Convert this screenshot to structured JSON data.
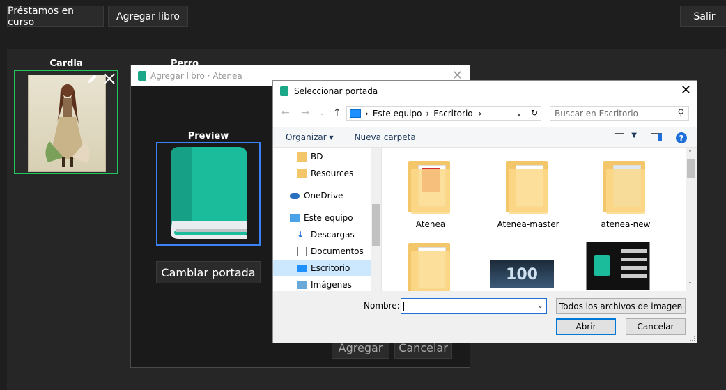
{
  "topbar": {
    "loans_label": "Préstamos en curso",
    "add_book_label": "Agregar libro",
    "exit_label": "Salir"
  },
  "library": {
    "books": [
      {
        "title": "Cardia"
      },
      {
        "title": "Perro"
      }
    ]
  },
  "add_dialog": {
    "title": "Agregar libro · Atenea",
    "preview_label": "Preview",
    "change_cover_label": "Cambiar portada",
    "add_label": "Agregar",
    "cancel_label": "Cancelar"
  },
  "file_dialog": {
    "title": "Seleccionar portada",
    "breadcrumb": [
      "Este equipo",
      "Escritorio"
    ],
    "search_placeholder": "Buscar en Escritorio",
    "organize_label": "Organizar",
    "new_folder_label": "Nueva carpeta",
    "sidebar": [
      {
        "label": "BD",
        "icon": "user-folder-icon"
      },
      {
        "label": "Resources",
        "icon": "folder-icon"
      },
      {
        "label": "OneDrive",
        "icon": "cloud-icon"
      },
      {
        "label": "Este equipo",
        "icon": "computer-icon"
      },
      {
        "label": "Descargas",
        "icon": "download-icon"
      },
      {
        "label": "Documentos",
        "icon": "document-icon"
      },
      {
        "label": "Escritorio",
        "icon": "desktop-icon",
        "selected": true
      },
      {
        "label": "Imágenes",
        "icon": "pictures-icon"
      }
    ],
    "items": [
      {
        "name": "Atenea"
      },
      {
        "name": "Atenea-master"
      },
      {
        "name": "atenea-new"
      }
    ],
    "thumbnail_text": "100",
    "filename_label": "Nombre:",
    "filename_value": "",
    "filter_label": "Todos los archivos de imagen",
    "open_label": "Abrir",
    "cancel_label": "Cancelar"
  },
  "colors": {
    "selected_card_border": "#22c55e",
    "preview_border": "#3b82f6",
    "book_icon": "#1abc9c"
  }
}
